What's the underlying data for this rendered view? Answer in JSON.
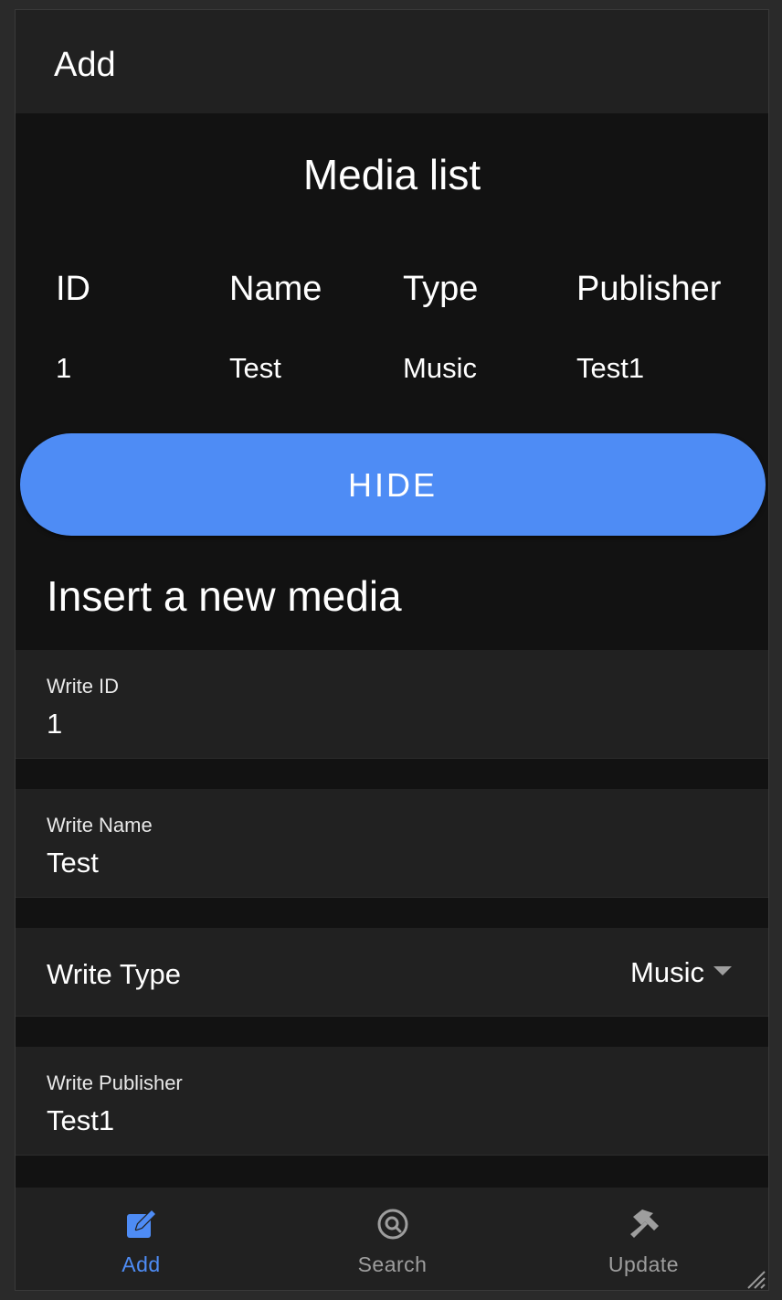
{
  "appbar": {
    "title": "Add"
  },
  "media_list": {
    "title": "Media list",
    "columns": [
      "ID",
      "Name",
      "Type",
      "Publisher"
    ],
    "rows": [
      [
        "1",
        "Test",
        "Music",
        "Test1"
      ]
    ],
    "hide_button": "HIDE"
  },
  "insert": {
    "title": "Insert a new media",
    "id_field": {
      "label": "Write ID",
      "value": "1"
    },
    "name_field": {
      "label": "Write Name",
      "value": "Test"
    },
    "type_field": {
      "label": "Write Type",
      "value": "Music"
    },
    "publisher_field": {
      "label": "Write Publisher",
      "value": "Test1"
    }
  },
  "bottom_nav": {
    "items": [
      {
        "label": "Add",
        "icon": "edit-icon",
        "active": true
      },
      {
        "label": "Search",
        "icon": "search-icon",
        "active": false
      },
      {
        "label": "Update",
        "icon": "hammer-icon",
        "active": false
      }
    ]
  },
  "colors": {
    "accent": "#4e8cf5",
    "surface": "#212121",
    "background": "#121212",
    "inactive": "#9e9e9e"
  }
}
